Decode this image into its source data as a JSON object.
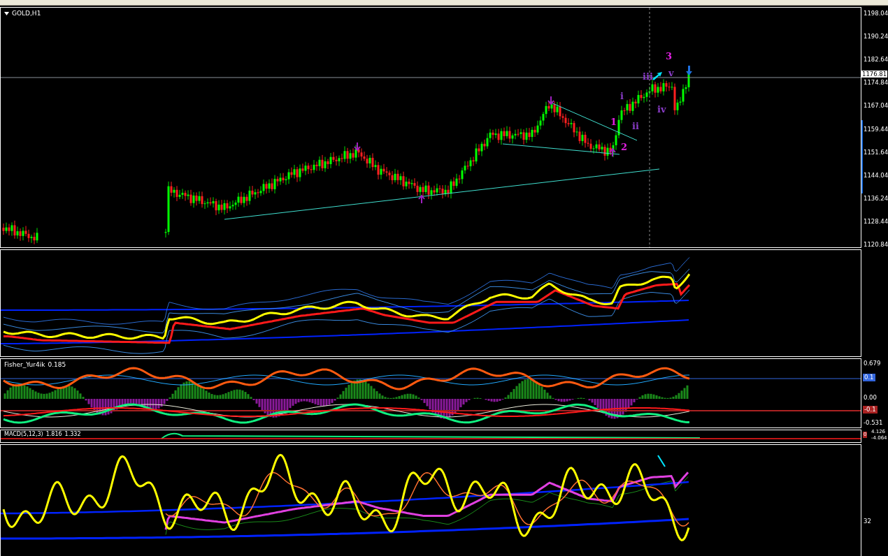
{
  "symbol_title": "GOLD,H1",
  "price_axis": {
    "ticks": [
      "1198.04",
      "1190.24",
      "1182.64",
      "1174.84",
      "1167.04",
      "1159.44",
      "1151.64",
      "1144.04",
      "1136.24",
      "1128.44",
      "1120.84"
    ],
    "current_price": "1176.81"
  },
  "wave_labels": [
    {
      "text": "3",
      "color": "#e020e0"
    },
    {
      "text": "iii",
      "color": "#8a3cc8"
    },
    {
      "text": "v",
      "color": "#8a3cc8"
    },
    {
      "text": "i",
      "color": "#8a3cc8"
    },
    {
      "text": "iv",
      "color": "#8a3cc8"
    },
    {
      "text": "1",
      "color": "#e020e0"
    },
    {
      "text": "ii",
      "color": "#8a3cc8"
    },
    {
      "text": "2",
      "color": "#e020e0"
    }
  ],
  "fisher": {
    "name": "Fisher_Yur4ik",
    "value": "0.185",
    "axis": [
      "0.679",
      "0.00",
      "-0.531"
    ],
    "levels": [
      {
        "label": "0.1",
        "color": "#3366dd"
      },
      {
        "label": "-0.1",
        "color": "#aa2222"
      }
    ]
  },
  "macd": {
    "name": "MACD(5,12,3)",
    "values": [
      "1.816",
      "1.332"
    ],
    "axis": [
      "4.126",
      "-4.064"
    ],
    "level_badge": "0"
  },
  "oscillator": {
    "axis": [
      "32"
    ]
  }
}
